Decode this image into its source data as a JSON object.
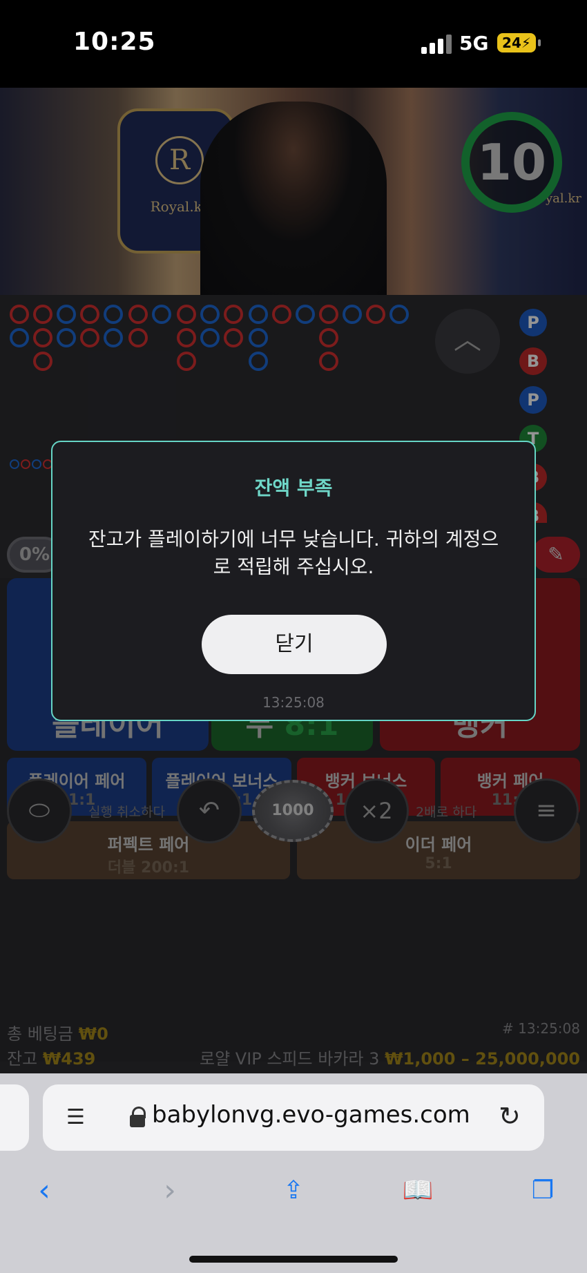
{
  "status_bar": {
    "time": "10:25",
    "network": "5G",
    "battery": "24"
  },
  "game": {
    "countdown": "10",
    "video_logo": "Royal.kr",
    "video_crest": "R",
    "video_right_logo": "yal.kr",
    "road_badges": [
      "P",
      "B",
      "P",
      "T",
      "B",
      "B"
    ],
    "pct_left": "0%",
    "bets": {
      "player": "플레이어",
      "tie": "무",
      "tie_odds": "8:1",
      "banker": "뱅커",
      "player_pair": "플레이어 페어",
      "player_pair_odds": "11:1",
      "player_bonus": "플레이어 보너스",
      "player_bonus_odds": "1~30:1",
      "banker_bonus": "뱅커 보너스",
      "banker_bonus_odds": "1~30:1",
      "banker_pair": "뱅커 페어",
      "banker_pair_odds": "11:1",
      "perfect_pair": "퍼펙트 페어",
      "perfect_pair_odds": "더블 200:1",
      "either_pair": "이더 페어",
      "either_pair_odds": "5:1"
    },
    "controls": {
      "undo_label": "실행 취소하다",
      "chip_value": "1000",
      "double_symbol": "×2",
      "double_label": "2배로 하다"
    },
    "footer": {
      "total_bet_label": "총 베팅금",
      "total_bet_value": "₩0",
      "balance_label": "잔고",
      "balance_value": "₩439",
      "round_id": "# 13:25:08",
      "table_name": "로얄 VIP 스피드 바카라 3",
      "limits": "₩1,000 – 25,000,000"
    }
  },
  "modal": {
    "title": "잔액 부족",
    "message": "잔고가 플레이하기에 너무 낮습니다. 귀하의 계정으로 적립해 주십시오.",
    "close_button": "닫기",
    "timestamp": "13:25:08"
  },
  "browser": {
    "url": "babylonvg.evo-games.com"
  },
  "colors": {
    "player_blue": "#1c3f8a",
    "banker_red": "#8f1b1f",
    "tie_green": "#1d6a2b",
    "accent_teal": "#66d5c6",
    "gold": "#a88a1a",
    "ios_blue": "#1877f2"
  }
}
